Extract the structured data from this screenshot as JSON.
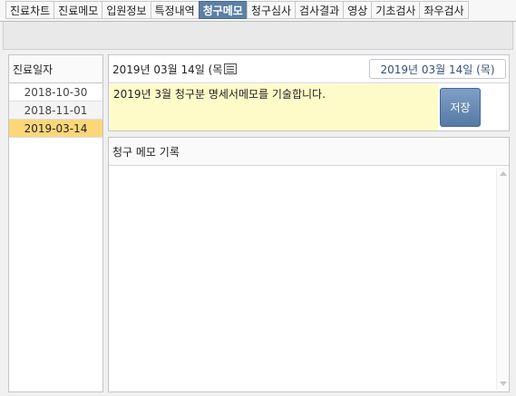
{
  "tabs": [
    {
      "label": "진료차트",
      "active": false
    },
    {
      "label": "진료메모",
      "active": false
    },
    {
      "label": "입원정보",
      "active": false
    },
    {
      "label": "특정내역",
      "active": false
    },
    {
      "label": "청구메모",
      "active": true
    },
    {
      "label": "청구심사",
      "active": false
    },
    {
      "label": "검사결과",
      "active": false
    },
    {
      "label": "영상",
      "active": false
    },
    {
      "label": "기초검사",
      "active": false
    },
    {
      "label": "좌우검사",
      "active": false
    }
  ],
  "left_panel": {
    "header": "진료일자",
    "dates": [
      "2018-10-30",
      "2018-11-01",
      "2019-03-14"
    ],
    "selected_index": 2
  },
  "memo": {
    "date_label": "2019년 03월 14일 (목",
    "date_button": "2019년 03월 14일 (목)",
    "text": "2019년 3월 청구분 명세서메모를 기술합니다.",
    "save_label": "저장"
  },
  "log": {
    "header": "청구 메모 기록"
  },
  "colors": {
    "active_tab": "#5b7fa6",
    "selected_row": "#fcd77a",
    "memo_bg": "#fffbc9",
    "save_button": "#5579a6"
  },
  "icons": {
    "calendar": "calendar-icon",
    "scroll_up": "scroll-up-icon",
    "scroll_down": "scroll-down-icon"
  }
}
